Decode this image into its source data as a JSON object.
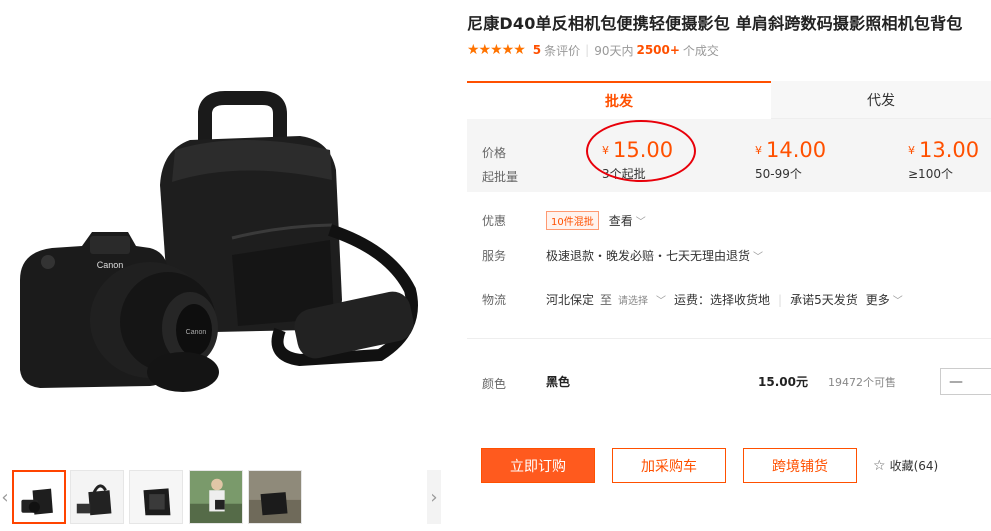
{
  "product": {
    "title": "尼康D40单反相机包便携轻便摄影包 单肩斜跨数码摄影照相机包背包",
    "stars": "★★★★★",
    "review_count": "5",
    "review_label": "条评价",
    "sales_period": "90天内",
    "sales_count": "2500+",
    "sales_label": "个成交"
  },
  "tabs": {
    "wholesale": "批发",
    "dropship": "代发"
  },
  "pricing": {
    "price_label": "价格",
    "moq_label": "起批量",
    "currency": "¥",
    "tiers": [
      {
        "price": "15.00",
        "qty": "3个起批"
      },
      {
        "price": "14.00",
        "qty": "50-99个"
      },
      {
        "price": "13.00",
        "qty": "≥100个"
      }
    ]
  },
  "promo": {
    "label": "优惠",
    "badge": "10件混批",
    "link": "查看"
  },
  "service": {
    "label": "服务",
    "text": "极速退款・晚发必赔・七天无理由退货"
  },
  "logistics": {
    "label": "物流",
    "from": "河北保定",
    "to_label": "至",
    "select_placeholder": "请选择",
    "freight": "运费：选择收货地",
    "promise": "承诺5天发货",
    "more": "更多"
  },
  "variant": {
    "label": "颜色",
    "name": "黑色",
    "price": "15.00元",
    "stock": "19472个可售",
    "decrement": "—"
  },
  "actions": {
    "buy_now": "立即订购",
    "add_cart": "加采购车",
    "cross_border": "跨境铺货",
    "favorite": "收藏(64)"
  },
  "icons": {
    "favorite": "star-outline-icon",
    "prev": "chevron-left-icon",
    "next": "chevron-right-icon",
    "dropdown": "chevron-down-icon"
  },
  "colors": {
    "accent": "#ff5000",
    "highlight_circle": "#e8000a",
    "panel_bg": "#f5f5f5"
  }
}
